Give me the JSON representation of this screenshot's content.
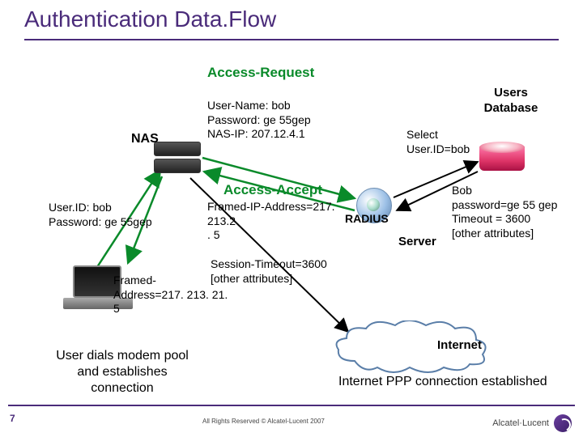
{
  "title": "Authentication Data.Flow",
  "nas_label": "NAS",
  "access_request": {
    "heading": "Access-Request",
    "line1": "User-Name: bob",
    "line2": "Password: ge 55gep",
    "line3": "NAS-IP: 207.12.4.1"
  },
  "access_accept": {
    "heading": "Access-Accept",
    "line1": "Framed-IP-Address=217. 213.2",
    "line2": ". 5"
  },
  "session": {
    "line1": "Session-Timeout=3600",
    "line2": "[other attributes]"
  },
  "user_creds": {
    "line1": "User.ID: bob",
    "line2": "Password: ge 55gep"
  },
  "framed_addr": {
    "line1": "Framed-",
    "line2": "Address=217. 213. 21. 5"
  },
  "select_query": {
    "line1": "Select",
    "line2": "User.ID=bob"
  },
  "radius_label": "RADIUS",
  "server_label": "Server",
  "usersdb_label": "Users Database",
  "bob_attrs": {
    "line1": "Bob",
    "line2": "password=ge 55 gep",
    "line3": "Timeout = 3600",
    "line4": "[other attributes]"
  },
  "internet_label": "Internet",
  "dials_text": "User dials modem pool and establishes connection",
  "ppp_text": "Internet PPP connection established",
  "page_number": "7",
  "rights": "All Rights Reserved © Alcatel-Lucent 2007",
  "brand": "Alcatel·Lucent"
}
